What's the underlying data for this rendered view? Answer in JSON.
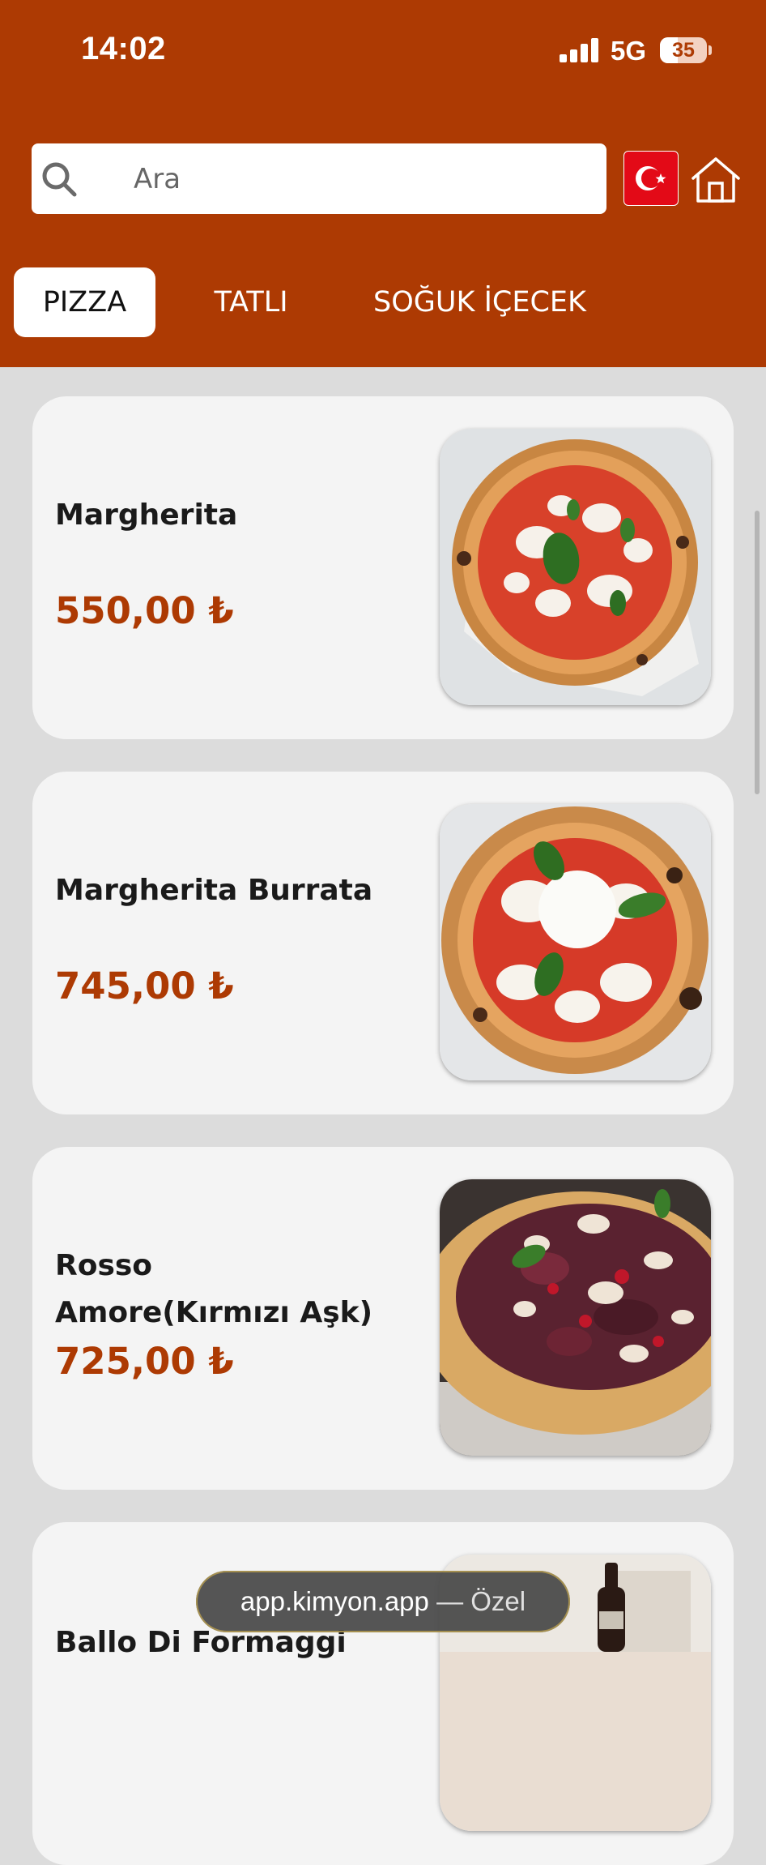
{
  "status_bar": {
    "time": "14:02",
    "network": "5G",
    "battery_level": "35"
  },
  "search": {
    "placeholder": "Ara"
  },
  "language_flag": "turkey-flag-icon",
  "tabs": [
    {
      "label": "PIZZA",
      "active": true
    },
    {
      "label": "TATLI",
      "active": false
    },
    {
      "label": "SOĞUK İÇECEK",
      "active": false
    }
  ],
  "menu_items": [
    {
      "name": "Margherita",
      "price": "550,00 ₺",
      "photo": "margherita-pizza"
    },
    {
      "name": "Margherita Burrata",
      "price": "745,00 ₺",
      "photo": "margherita-burrata-pizza"
    },
    {
      "name": "Rosso Amore(Kırmızı Aşk)",
      "price": "725,00 ₺",
      "photo": "rosso-amore-pizza"
    },
    {
      "name": "Ballo Di Formaggi",
      "price": "",
      "photo": "ballo-di-formaggi-pizza"
    }
  ],
  "browser": {
    "url": "app.kimyon.app",
    "mode": "— Özel"
  },
  "colors": {
    "brand": "#ad3a03",
    "card_background": "#f4f4f4",
    "page_background": "#dcdcdc"
  }
}
